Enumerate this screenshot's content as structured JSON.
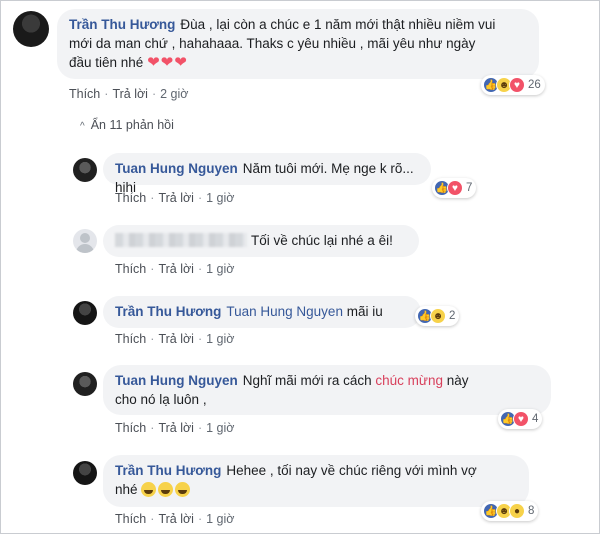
{
  "top_comment": {
    "author": "Trần Thu Hương",
    "text_line1": "Đùa , lại còn a chúc e 1 năm mới thật nhiều niềm vui",
    "text_line2": "mới da man chứ , hahahaaa. Thaks c yêu nhiều , mãi yêu như ngày",
    "text_line3": "đầu tiên nhé",
    "hearts": "❤❤❤",
    "like": "Thích",
    "reply": "Trả lời",
    "time": "2 giờ",
    "reaction_count": "26",
    "reaction_icons": [
      "like-icon",
      "haha-icon",
      "love-icon"
    ]
  },
  "toggle": {
    "chevron": "^",
    "label": "Ẩn 11 phản hồi"
  },
  "replies": [
    {
      "author": "Tuan Hung Nguyen",
      "text": "Năm tuôi mới. Mẹ nge k rõ... hihi",
      "like": "Thích",
      "reply": "Trả lời",
      "time": "1 giờ",
      "reaction_count": "7",
      "reaction_icons": [
        "like-icon",
        "love-icon"
      ]
    },
    {
      "author": "",
      "text": "Tối về chúc lại nhé a êi!",
      "like": "Thích",
      "reply": "Trả lời",
      "time": "1 giờ"
    },
    {
      "author": "Trần Thu Hương",
      "mention": "Tuan Hung Nguyen",
      "text": "mãi iu",
      "like": "Thích",
      "reply": "Trả lời",
      "time": "1 giờ",
      "reaction_count": "2",
      "reaction_icons": [
        "like-icon",
        "haha-icon"
      ]
    },
    {
      "author": "Tuan Hung Nguyen",
      "text_before": "Nghĩ mãi mới ra cách",
      "highlight": "chúc mừng",
      "text_after": "này",
      "text_line2": "cho nó lạ luôn ,",
      "like": "Thích",
      "reply": "Trả lời",
      "time": "1 giờ",
      "reaction_count": "4",
      "reaction_icons": [
        "like-icon",
        "love-icon"
      ]
    },
    {
      "author": "Trần Thu Hương",
      "text_line1": "Hehee , tối nay về chúc riêng với mình vợ",
      "text_line2": "nhé",
      "like": "Thích",
      "reply": "Trả lời",
      "time": "1 giờ",
      "reaction_count": "8",
      "reaction_icons": [
        "like-icon",
        "haha-icon",
        "wow-icon"
      ]
    }
  ],
  "colors": {
    "name": "#365899",
    "bubble": "#f2f3f5",
    "like": "#4267b2",
    "love": "#f25268",
    "highlight": "#d8405c"
  }
}
